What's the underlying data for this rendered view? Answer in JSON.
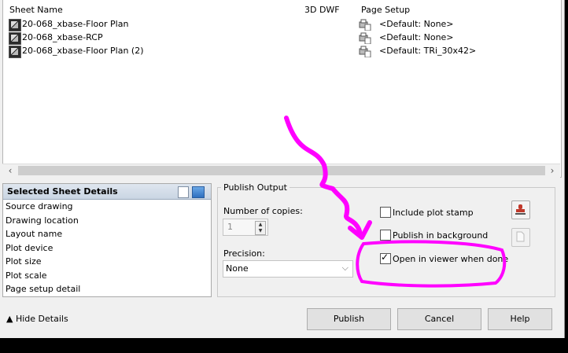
{
  "sheet_list": {
    "columns": [
      "Sheet Name",
      "3D DWF",
      "Page Setup"
    ],
    "rows": [
      {
        "name": "20-068_xbase-Floor Plan",
        "page_setup": "<Default: None>"
      },
      {
        "name": "20-068_xbase-RCP",
        "page_setup": "<Default: None>"
      },
      {
        "name": "20-068_xbase-Floor Plan (2)",
        "page_setup": "<Default: TRi_30x42>"
      }
    ]
  },
  "details": {
    "title": "Selected Sheet Details",
    "items": [
      "Source drawing",
      "Drawing location",
      "Layout name",
      "Plot device",
      "Plot size",
      "Plot scale",
      "Page setup detail"
    ]
  },
  "publish_output": {
    "legend": "Publish Output",
    "copies_label": "Number of copies:",
    "copies_value": "1",
    "precision_label": "Precision:",
    "precision_value": "None",
    "include_plot_stamp": "Include plot stamp",
    "publish_background": "Publish in background",
    "open_viewer": "Open in viewer when done"
  },
  "buttons": {
    "hide_details": "Hide Details",
    "publish": "Publish",
    "cancel": "Cancel",
    "help": "Help"
  },
  "colors": {
    "annotation": "#ff00ff"
  }
}
